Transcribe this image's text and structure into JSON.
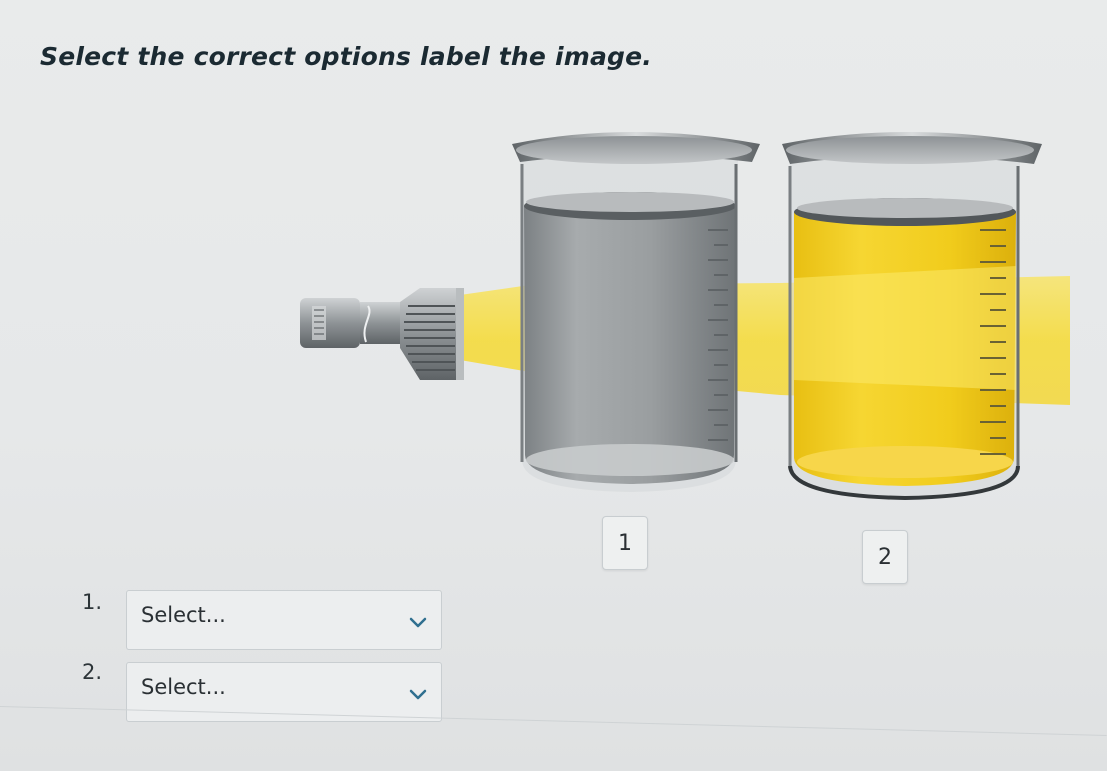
{
  "question": {
    "title": "Select the correct options label the image."
  },
  "figure": {
    "beaker_labels": [
      "1",
      "2"
    ],
    "colors": {
      "light_beam": "#f5e05a",
      "liquid_clear": "#9a9ea0",
      "liquid_colloid": "#f2cf22",
      "flashlight_body": "#8e9396"
    },
    "icons": [
      "flashlight-icon",
      "beaker-icon"
    ]
  },
  "answers": [
    {
      "number": "1.",
      "selected": "Select..."
    },
    {
      "number": "2.",
      "selected": "Select..."
    }
  ]
}
